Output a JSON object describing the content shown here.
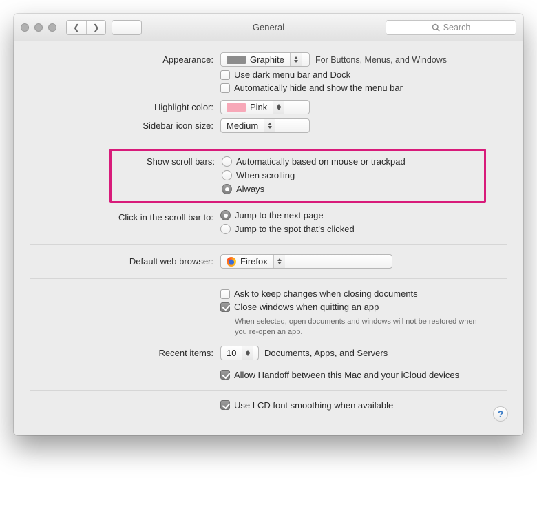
{
  "toolbar": {
    "title": "General",
    "search_placeholder": "Search"
  },
  "appearance": {
    "label": "Appearance:",
    "value": "Graphite",
    "swatch": "#8c8c8c",
    "note": "For Buttons, Menus, and Windows",
    "dark_menu": "Use dark menu bar and Dock",
    "auto_hide": "Automatically hide and show the menu bar"
  },
  "highlight": {
    "label": "Highlight color:",
    "value": "Pink",
    "swatch": "#f7a8b8"
  },
  "sidebar": {
    "label": "Sidebar icon size:",
    "value": "Medium"
  },
  "scrollbars": {
    "label": "Show scroll bars:",
    "options": {
      "auto": "Automatically based on mouse or trackpad",
      "scrolling": "When scrolling",
      "always": "Always"
    }
  },
  "click_scroll": {
    "label": "Click in the scroll bar to:",
    "opt1": "Jump to the next page",
    "opt2": "Jump to the spot that's clicked"
  },
  "browser": {
    "label": "Default web browser:",
    "value": "Firefox"
  },
  "docs": {
    "ask_keep": "Ask to keep changes when closing documents",
    "close_windows": "Close windows when quitting an app",
    "close_note": "When selected, open documents and windows will not be restored when you re-open an app."
  },
  "recent": {
    "label": "Recent items:",
    "value": "10",
    "suffix": "Documents, Apps, and Servers",
    "handoff": "Allow Handoff between this Mac and your iCloud devices"
  },
  "lcd": {
    "label": "Use LCD font smoothing when available"
  },
  "help": "?"
}
